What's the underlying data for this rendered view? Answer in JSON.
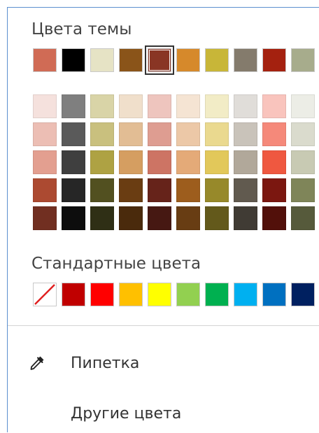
{
  "theme_colors": {
    "title": "Цвета темы",
    "base": [
      {
        "color": "#d06b55",
        "selected": false
      },
      {
        "color": "#000000",
        "selected": false
      },
      {
        "color": "#e6e3c5",
        "selected": false
      },
      {
        "color": "#8a5419",
        "selected": false
      },
      {
        "color": "#893524",
        "selected": true
      },
      {
        "color": "#d6892b",
        "selected": false
      },
      {
        "color": "#c8b638",
        "selected": false
      },
      {
        "color": "#847b6c",
        "selected": false
      },
      {
        "color": "#a4210f",
        "selected": false
      },
      {
        "color": "#a7ac8c",
        "selected": false
      }
    ],
    "tints": [
      [
        "#f5e1dd",
        "#7f7f7f",
        "#d9d4a7",
        "#f0dfcb",
        "#eec5be",
        "#f5e4d3",
        "#f2ecc6",
        "#e0ddd9",
        "#f9c4bd",
        "#ecede6"
      ],
      [
        "#ecbeb4",
        "#5a5a5a",
        "#c9c07e",
        "#e2bd94",
        "#de9d91",
        "#ecc8a7",
        "#ead98f",
        "#c9c3ba",
        "#f5897a",
        "#dadbcd"
      ],
      [
        "#e39f90",
        "#3f3f3f",
        "#aea243",
        "#d59e61",
        "#cd7464",
        "#e4aa78",
        "#e2c85a",
        "#b1a89a",
        "#ef5840",
        "#c8cab3"
      ],
      [
        "#ac4a31",
        "#262626",
        "#525020",
        "#6a3d12",
        "#66231a",
        "#9d5d1d",
        "#97892a",
        "#615a4f",
        "#7b1710",
        "#7f8559"
      ],
      [
        "#712f21",
        "#0d0d0d",
        "#2f2f15",
        "#4a2a0c",
        "#461812",
        "#683d13",
        "#63591b",
        "#403b34",
        "#52100a",
        "#565a3b"
      ]
    ]
  },
  "standard_colors": {
    "title": "Стандартные цвета",
    "items": [
      {
        "color": "#ffffff",
        "name": "no-color"
      },
      {
        "color": "#c00000",
        "name": "dark-red"
      },
      {
        "color": "#ff0000",
        "name": "red"
      },
      {
        "color": "#ffc000",
        "name": "orange"
      },
      {
        "color": "#ffff00",
        "name": "yellow"
      },
      {
        "color": "#92d050",
        "name": "light-green"
      },
      {
        "color": "#00b050",
        "name": "green"
      },
      {
        "color": "#00b0f0",
        "name": "light-blue"
      },
      {
        "color": "#0070c0",
        "name": "blue"
      },
      {
        "color": "#002060",
        "name": "dark-blue"
      }
    ]
  },
  "menu": {
    "eyedropper_label": "Пипетка",
    "eyedropper_icon": "eyedropper-icon",
    "more_colors_label": "Другие цвета"
  }
}
